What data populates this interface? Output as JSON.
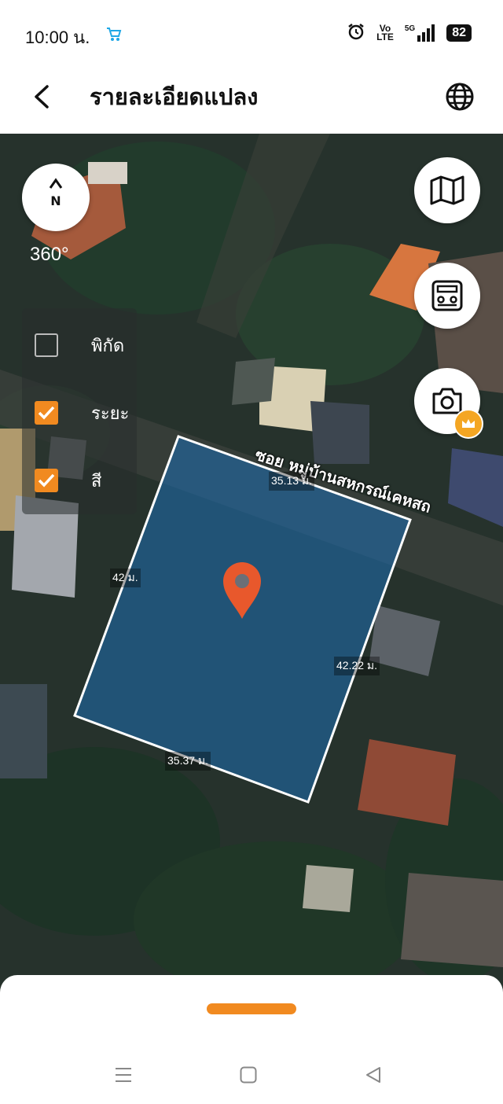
{
  "status_bar": {
    "time": "10:00 น.",
    "network_top": "Vo",
    "network_bottom": "LTE",
    "signal": "5G",
    "battery": "82"
  },
  "header": {
    "title": "รายละเอียดแปลง"
  },
  "map": {
    "compass_label": "N",
    "rotation_label": "360°",
    "layers": [
      {
        "label": "พิกัด",
        "checked": false
      },
      {
        "label": "ระยะ",
        "checked": true
      },
      {
        "label": "สี",
        "checked": true
      }
    ],
    "street_name": "ซอย หมู่บ้านสหกรณ์เคหสถ",
    "dimensions": {
      "top": "35.13 ม.",
      "left": "42 ม.",
      "right": "42.22 ม.",
      "bottom": "35.37 ม."
    }
  },
  "colors": {
    "accent": "#f18a20",
    "parcel_fill": "#1e6fb5",
    "pin": "#e8582c"
  }
}
